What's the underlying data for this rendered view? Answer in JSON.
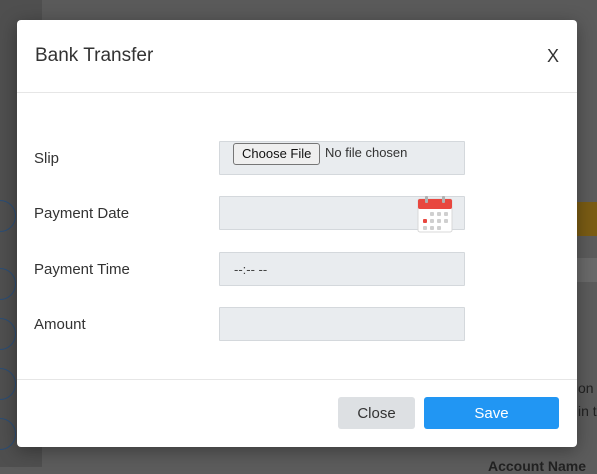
{
  "background": {
    "fragment_1": "on",
    "fragment_2": "in t",
    "fragment_3": "Account Name"
  },
  "modal": {
    "title": "Bank Transfer",
    "close_glyph": "X",
    "fields": {
      "slip": {
        "label": "Slip",
        "button": "Choose File",
        "status": "No file chosen"
      },
      "payment_date": {
        "label": "Payment Date",
        "value": "",
        "icon": "calendar-icon"
      },
      "payment_time": {
        "label": "Payment Time",
        "value": "--:-- --"
      },
      "amount": {
        "label": "Amount",
        "value": ""
      }
    },
    "buttons": {
      "close": "Close",
      "save": "Save"
    }
  },
  "colors": {
    "save_button": "#2196f3",
    "close_button": "#dde0e3",
    "input_bg": "#e9ecef",
    "overlay": "#5c5c5c",
    "calendar_red": "#e8473f"
  }
}
